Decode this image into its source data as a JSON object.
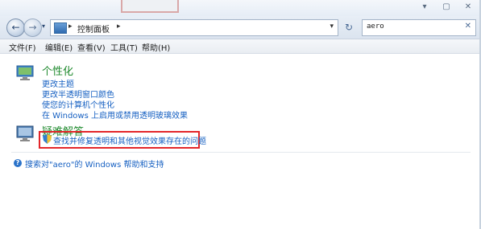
{
  "window": {
    "min_glyph": "▾",
    "max_glyph": "▢",
    "close_glyph": "✕"
  },
  "nav": {
    "back_glyph": "←",
    "forward_glyph": "→",
    "history_glyph": "▾"
  },
  "address": {
    "sep_glyph": "▸",
    "label": "控制面板",
    "sep2_glyph": "▸",
    "dropdown_glyph": "▾"
  },
  "refresh_glyph": "↻",
  "search": {
    "value": "aero",
    "clear_glyph": "✕"
  },
  "menu": [
    "文件(F)",
    "编辑(E)",
    "查看(V)",
    "工具(T)",
    "帮助(H)"
  ],
  "personalization": {
    "heading": "个性化",
    "links": [
      "更改主题",
      "更改半透明窗口颜色",
      "使您的计算机个性化",
      "在 Windows 上启用或禁用透明玻璃效果"
    ]
  },
  "troubleshooting": {
    "heading": "疑难解答",
    "links": [
      "查找并修复透明和其他视觉效果存在的问题"
    ]
  },
  "help_link": "搜索对\"aero\"的 Windows 帮助和支持",
  "colors": {
    "heading": "#1f8a2e",
    "link": "#1660c2",
    "highlight": "#e3262a"
  }
}
